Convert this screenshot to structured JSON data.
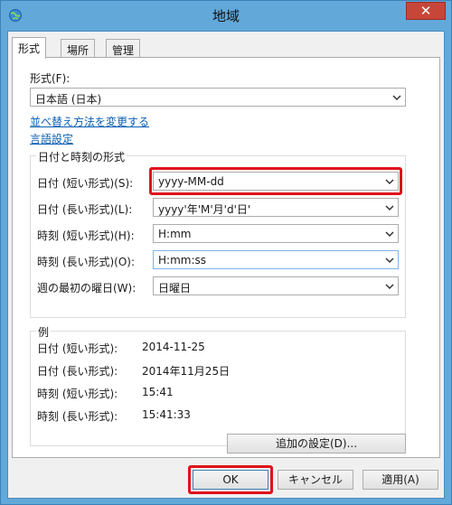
{
  "window": {
    "title": "地域",
    "close_symbol": "✕",
    "icons": {
      "app": "globe-icon",
      "close": "close-icon",
      "dropdown": "chevron-down-icon"
    }
  },
  "tabs": [
    {
      "label": "形式",
      "active": true
    },
    {
      "label": "場所",
      "active": false
    },
    {
      "label": "管理",
      "active": false
    }
  ],
  "format": {
    "label": "形式(F):",
    "value": "日本語 (日本)",
    "sort_link": "並べ替え方法を変更する",
    "language_link": "言語設定"
  },
  "datetime_group": {
    "title": "日付と時刻の形式",
    "rows": [
      {
        "label": "日付 (短い形式)(S):",
        "value": "yyyy-MM-dd"
      },
      {
        "label": "日付 (長い形式)(L):",
        "value": "yyyy'年'M'月'd'日'"
      },
      {
        "label": "時刻 (短い形式)(H):",
        "value": "H:mm"
      },
      {
        "label": "時刻 (長い形式)(O):",
        "value": "H:mm:ss"
      },
      {
        "label": "週の最初の曜日(W):",
        "value": "日曜日"
      }
    ]
  },
  "examples": {
    "title": "例",
    "rows": [
      {
        "label": "日付 (短い形式):",
        "value": "2014-11-25"
      },
      {
        "label": "日付 (長い形式):",
        "value": "2014年11月25日"
      },
      {
        "label": "時刻 (短い形式):",
        "value": "15:41"
      },
      {
        "label": "時刻 (長い形式):",
        "value": "15:41:33"
      }
    ]
  },
  "buttons": {
    "additional": "追加の設定(D)...",
    "ok": "OK",
    "cancel": "キャンセル",
    "apply": "適用(A)"
  },
  "colors": {
    "highlight": "#e0131b",
    "link": "#0a5fb3",
    "close_button": "#c7463a",
    "titlebar": "#62a8d9"
  }
}
